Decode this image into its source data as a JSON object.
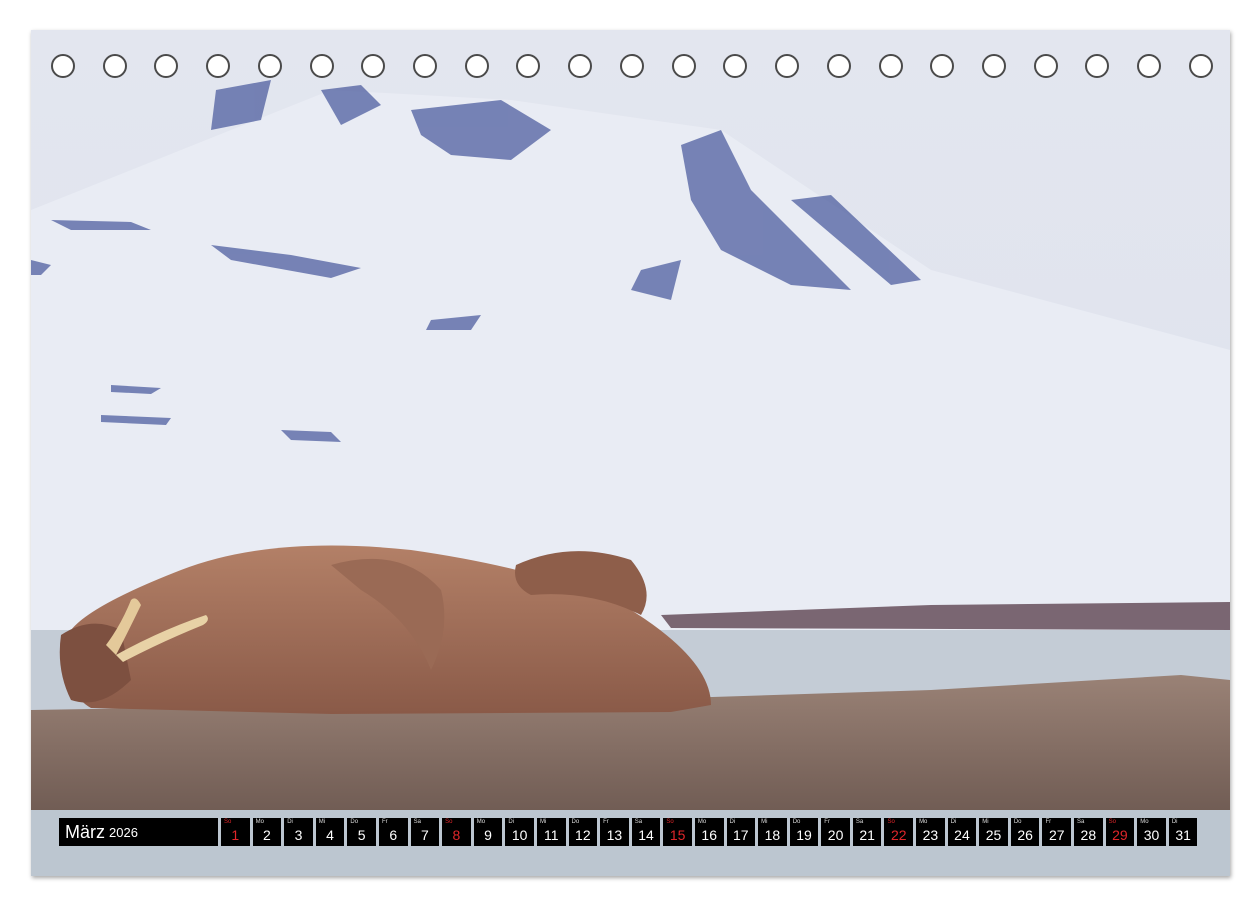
{
  "calendar": {
    "month": "März",
    "year": "2026",
    "days": [
      {
        "wd": "So",
        "num": "1",
        "sunday": true
      },
      {
        "wd": "Mo",
        "num": "2"
      },
      {
        "wd": "Di",
        "num": "3"
      },
      {
        "wd": "Mi",
        "num": "4"
      },
      {
        "wd": "Do",
        "num": "5"
      },
      {
        "wd": "Fr",
        "num": "6"
      },
      {
        "wd": "Sa",
        "num": "7"
      },
      {
        "wd": "So",
        "num": "8",
        "sunday": true
      },
      {
        "wd": "Mo",
        "num": "9"
      },
      {
        "wd": "Di",
        "num": "10"
      },
      {
        "wd": "Mi",
        "num": "11"
      },
      {
        "wd": "Do",
        "num": "12"
      },
      {
        "wd": "Fr",
        "num": "13"
      },
      {
        "wd": "Sa",
        "num": "14"
      },
      {
        "wd": "So",
        "num": "15",
        "sunday": true
      },
      {
        "wd": "Mo",
        "num": "16"
      },
      {
        "wd": "Di",
        "num": "17"
      },
      {
        "wd": "Mi",
        "num": "18"
      },
      {
        "wd": "Do",
        "num": "19"
      },
      {
        "wd": "Fr",
        "num": "20"
      },
      {
        "wd": "Sa",
        "num": "21"
      },
      {
        "wd": "So",
        "num": "22",
        "sunday": true
      },
      {
        "wd": "Mo",
        "num": "23"
      },
      {
        "wd": "Di",
        "num": "24"
      },
      {
        "wd": "Mi",
        "num": "25"
      },
      {
        "wd": "Do",
        "num": "26"
      },
      {
        "wd": "Fr",
        "num": "27"
      },
      {
        "wd": "Sa",
        "num": "28"
      },
      {
        "wd": "So",
        "num": "29",
        "sunday": true
      },
      {
        "wd": "Mo",
        "num": "30"
      },
      {
        "wd": "Di",
        "num": "31"
      }
    ]
  },
  "binding_holes": 23,
  "colors": {
    "sunday": "#e0262a",
    "bar": "#000000",
    "snow": "#e6e9f2",
    "rock": "#4a5a9a",
    "walrus": "#a0705a",
    "gravel": "#8a7266",
    "water": "#b8c2cc"
  }
}
